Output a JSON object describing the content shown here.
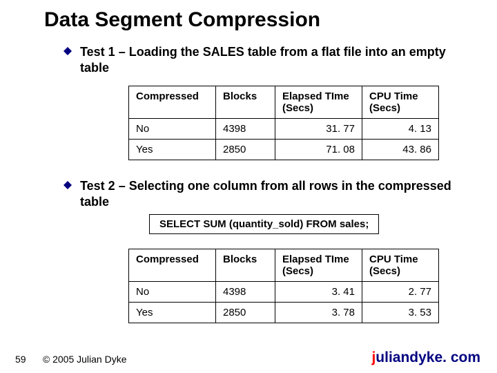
{
  "title": "Data Segment Compression",
  "bullet1": "Test 1 – Loading the SALES table from a flat file into an empty table",
  "bullet2": "Test 2 – Selecting one column from all rows in the compressed table",
  "sql": "SELECT SUM (quantity_sold) FROM sales;",
  "table_headers": {
    "compressed": "Compressed",
    "blocks": "Blocks",
    "elapsed": "Elapsed TIme (Secs)",
    "cpu": "CPU Time (Secs)"
  },
  "table1": {
    "rows": [
      {
        "compressed": "No",
        "blocks": "4398",
        "elapsed": "31. 77",
        "cpu": "4. 13"
      },
      {
        "compressed": "Yes",
        "blocks": "2850",
        "elapsed": "71. 08",
        "cpu": "43. 86"
      }
    ]
  },
  "table2": {
    "rows": [
      {
        "compressed": "No",
        "blocks": "4398",
        "elapsed": "3. 41",
        "cpu": "2. 77"
      },
      {
        "compressed": "Yes",
        "blocks": "2850",
        "elapsed": "3. 78",
        "cpu": "3. 53"
      }
    ]
  },
  "footer": {
    "page": "59",
    "copyright": "© 2005 Julian Dyke",
    "site_first": "j",
    "site_rest": "uliandyke. com"
  },
  "chart_data": [
    {
      "type": "table",
      "title": "Test 1 – Loading the SALES table from a flat file into an empty table",
      "columns": [
        "Compressed",
        "Blocks",
        "Elapsed TIme (Secs)",
        "CPU Time (Secs)"
      ],
      "rows": [
        [
          "No",
          4398,
          31.77,
          4.13
        ],
        [
          "Yes",
          2850,
          71.08,
          43.86
        ]
      ]
    },
    {
      "type": "table",
      "title": "Test 2 – Selecting one column from all rows in the compressed table",
      "columns": [
        "Compressed",
        "Blocks",
        "Elapsed TIme (Secs)",
        "CPU Time (Secs)"
      ],
      "rows": [
        [
          "No",
          4398,
          3.41,
          2.77
        ],
        [
          "Yes",
          2850,
          3.78,
          3.53
        ]
      ]
    }
  ]
}
